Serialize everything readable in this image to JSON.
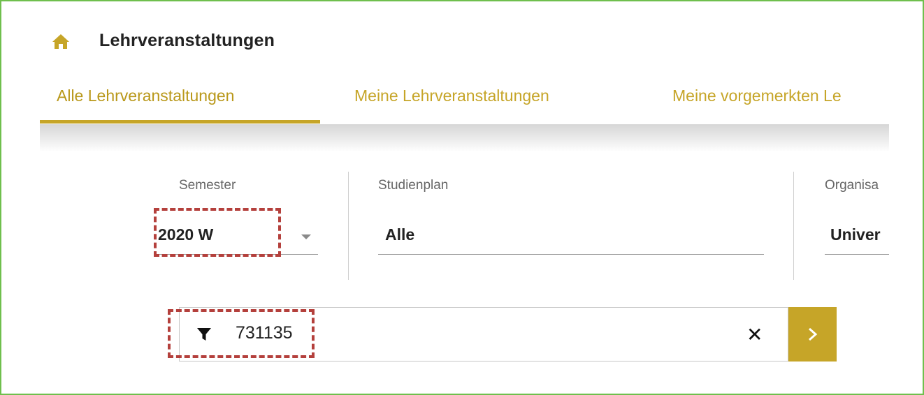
{
  "header": {
    "title": "Lehrveranstaltungen",
    "home_icon": "home-icon"
  },
  "tabs": [
    {
      "label": "Alle Lehrveranstaltungen",
      "active": true
    },
    {
      "label": "Meine Lehrveranstaltungen",
      "active": false
    },
    {
      "label": "Meine vorgemerkten Le",
      "active": false
    }
  ],
  "filters": {
    "semester": {
      "label": "Semester",
      "value": "2020 W"
    },
    "studienplan": {
      "label": "Studienplan",
      "value": "Alle"
    },
    "organisation": {
      "label": "Organisa",
      "value": "Univer"
    }
  },
  "search": {
    "value": "731135",
    "filter_icon": "filter-icon",
    "clear_icon": "close-icon",
    "submit_icon": "chevron-right-icon"
  },
  "colors": {
    "accent": "#c6a528",
    "annotation": "#b4403c",
    "frame": "#6fbf4d"
  }
}
